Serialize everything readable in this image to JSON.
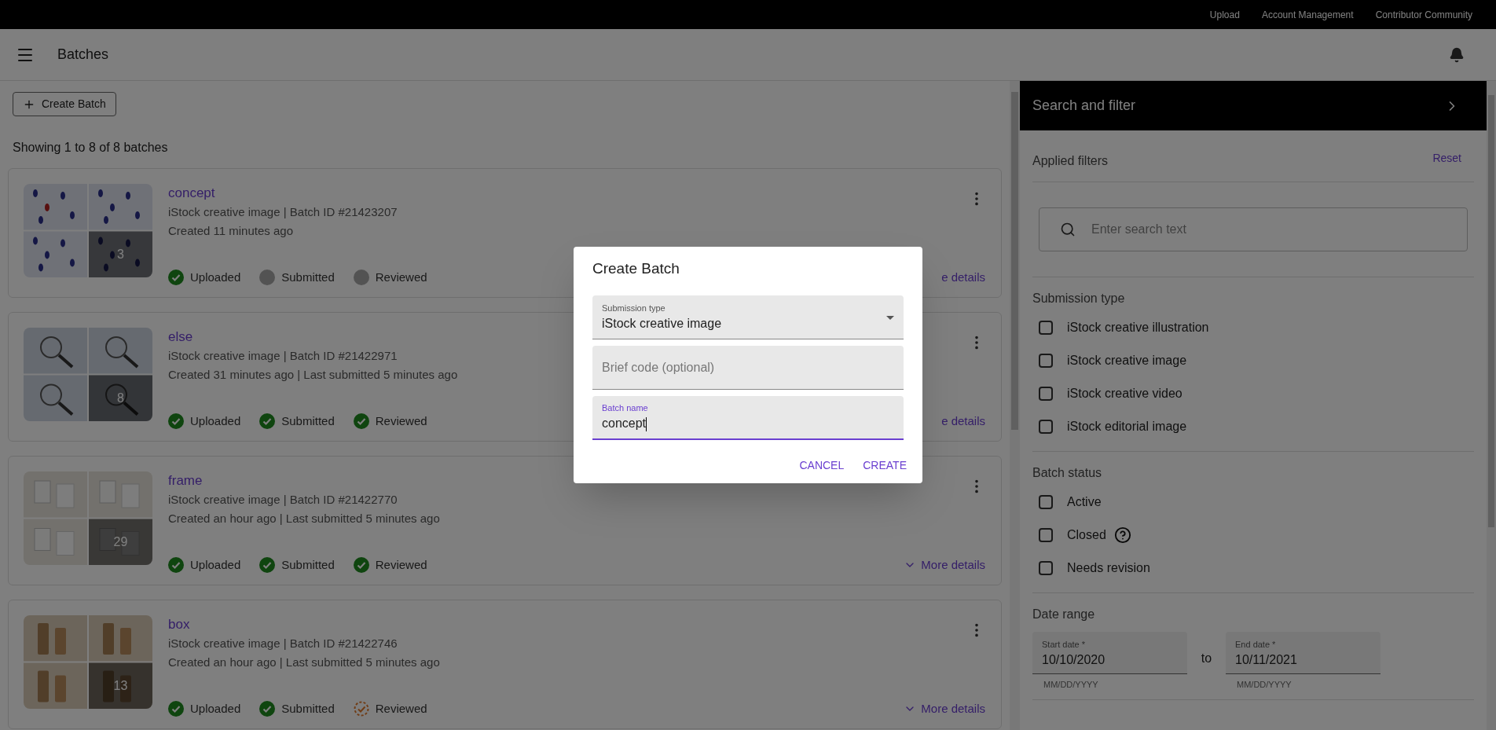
{
  "top_links": [
    "Upload",
    "Account Management",
    "Contributor Community"
  ],
  "header": {
    "title": "Batches"
  },
  "create_button": "Create Batch",
  "summary": "Showing 1 to 8 of 8 batches",
  "batches": [
    {
      "name": "concept",
      "type_line": "iStock creative image | Batch ID #21423207",
      "created_line": "Created 11 minutes ago",
      "count": "3",
      "statuses": [
        {
          "label": "Uploaded",
          "kind": "done"
        },
        {
          "label": "Submitted",
          "kind": "pending"
        },
        {
          "label": "Reviewed",
          "kind": "pending"
        }
      ],
      "more_details": {
        "label": "e details",
        "icon": false
      }
    },
    {
      "name": "else",
      "type_line": "iStock creative image | Batch ID #21422971",
      "created_line": "Created 31 minutes ago | Last submitted 5 minutes ago",
      "count": "8",
      "statuses": [
        {
          "label": "Uploaded",
          "kind": "done"
        },
        {
          "label": "Submitted",
          "kind": "done"
        },
        {
          "label": "Reviewed",
          "kind": "done"
        }
      ],
      "more_details": {
        "label": "e details",
        "icon": false
      }
    },
    {
      "name": "frame",
      "type_line": "iStock creative image | Batch ID #21422770",
      "created_line": "Created an hour ago | Last submitted 5 minutes ago",
      "count": "29",
      "statuses": [
        {
          "label": "Uploaded",
          "kind": "done"
        },
        {
          "label": "Submitted",
          "kind": "done"
        },
        {
          "label": "Reviewed",
          "kind": "done"
        }
      ],
      "more_details": {
        "label": "More details",
        "icon": true
      }
    },
    {
      "name": "box",
      "type_line": "iStock creative image | Batch ID #21422746",
      "created_line": "Created an hour ago | Last submitted 5 minutes ago",
      "count": "13",
      "statuses": [
        {
          "label": "Uploaded",
          "kind": "done"
        },
        {
          "label": "Submitted",
          "kind": "done"
        },
        {
          "label": "Reviewed",
          "kind": "in_review"
        }
      ],
      "more_details": {
        "label": "More details",
        "icon": true
      }
    }
  ],
  "filters": {
    "title": "Search and filter",
    "applied_label": "Applied filters",
    "reset": "Reset",
    "search": {
      "placeholder": "Enter search text"
    },
    "sections": [
      {
        "title": "Submission type",
        "options": [
          {
            "label": "iStock creative illustration",
            "checked": false,
            "help": false
          },
          {
            "label": "iStock creative image",
            "checked": false,
            "help": false
          },
          {
            "label": "iStock creative video",
            "checked": false,
            "help": false
          },
          {
            "label": "iStock editorial image",
            "checked": false,
            "help": false
          }
        ]
      },
      {
        "title": "Batch status",
        "options": [
          {
            "label": "Active",
            "checked": false,
            "help": false
          },
          {
            "label": "Closed",
            "checked": false,
            "help": true
          },
          {
            "label": "Needs revision",
            "checked": false,
            "help": false
          }
        ]
      }
    ],
    "date_range": {
      "title": "Date range",
      "start": {
        "label": "Start date *",
        "value": "10/10/2020",
        "helper": "MM/DD/YYYY"
      },
      "separator": "to",
      "end": {
        "label": "End date *",
        "value": "10/11/2021",
        "helper": "MM/DD/YYYY"
      }
    }
  },
  "dialog": {
    "title": "Create Batch",
    "fields": [
      {
        "kind": "select",
        "label": "Submission type",
        "value": "iStock creative image",
        "focused": false
      },
      {
        "kind": "text",
        "placeholder": "Brief code (optional)",
        "focused": false
      },
      {
        "kind": "text",
        "label": "Batch name",
        "value": "concept",
        "focused": true
      }
    ],
    "actions": [
      "CANCEL",
      "CREATE"
    ]
  }
}
